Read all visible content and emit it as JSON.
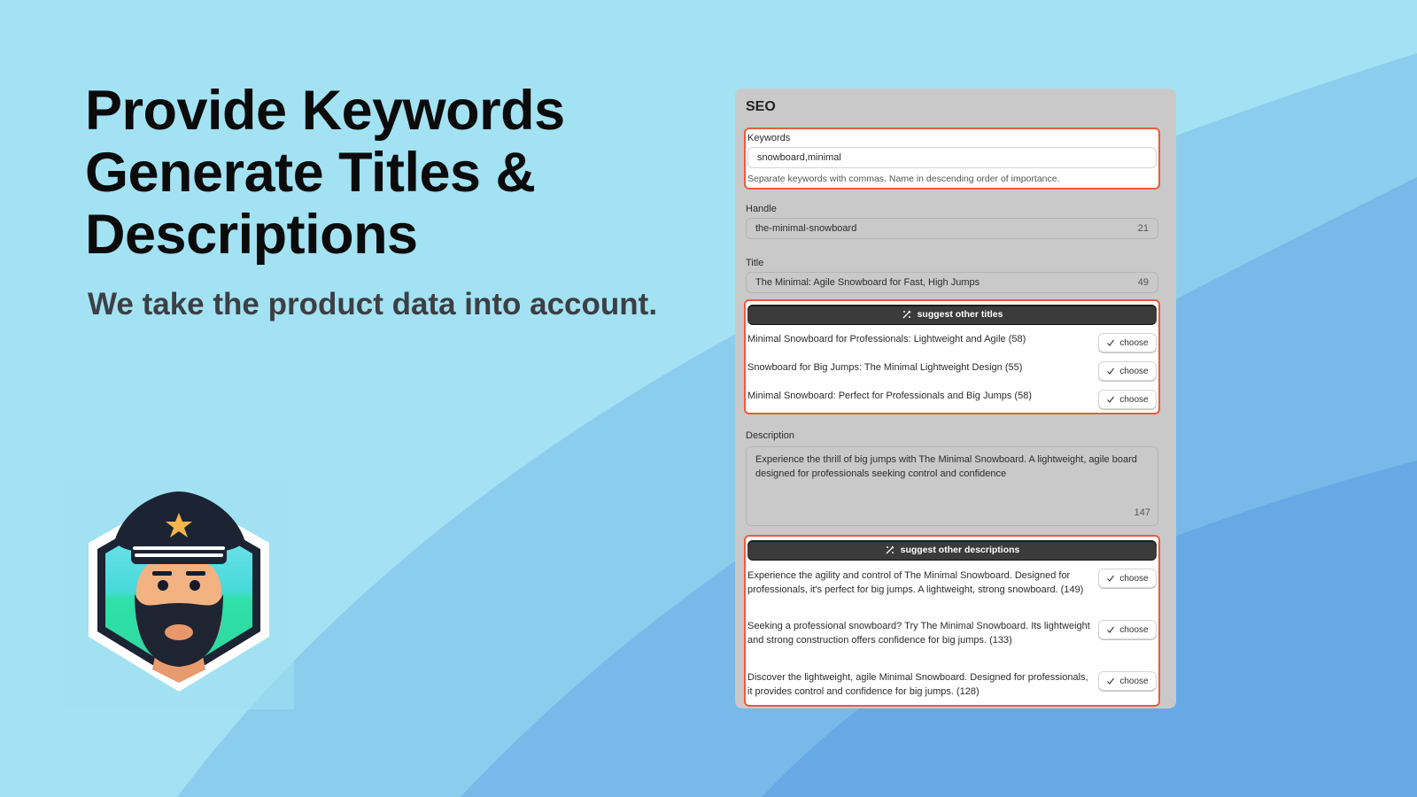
{
  "hero": {
    "title_lines": [
      "Provide Keywords",
      "Generate Titles &",
      "Descriptions"
    ],
    "subtitle": "We take the product data into account."
  },
  "mascot": {
    "icon": "captain-avatar-icon"
  },
  "panel": {
    "title": "SEO",
    "keywords": {
      "label": "Keywords",
      "value": "snowboard,minimal",
      "help": "Separate keywords with commas. Name in descending order of importance."
    },
    "handle": {
      "label": "Handle",
      "value": "the-minimal-snowboard",
      "count": "21"
    },
    "title_field": {
      "label": "Title",
      "value": "The Minimal: Agile Snowboard for Fast, High Jumps",
      "count": "49"
    },
    "suggest_titles": {
      "button_label": "suggest other titles",
      "icon": "magic-wand-icon",
      "items": [
        {
          "text": "Minimal Snowboard for Professionals: Lightweight and Agile (58)",
          "action": "choose"
        },
        {
          "text": "Snowboard for Big Jumps: The Minimal Lightweight Design (55)",
          "action": "choose"
        },
        {
          "text": "Minimal Snowboard: Perfect for Professionals and Big Jumps (58)",
          "action": "choose"
        }
      ]
    },
    "description": {
      "label": "Description",
      "value": "Experience the thrill of big jumps with The Minimal Snowboard. A lightweight, agile board designed for professionals seeking control and confidence",
      "count": "147"
    },
    "suggest_descriptions": {
      "button_label": "suggest other descriptions",
      "icon": "magic-wand-icon",
      "items": [
        {
          "text": "Experience the agility and control of The Minimal Snowboard. Designed for professionals, it's perfect for big jumps. A lightweight, strong snowboard. (149)",
          "action": "choose"
        },
        {
          "text": "Seeking a professional snowboard? Try The Minimal Snowboard. Its lightweight and strong construction offers confidence for big jumps. (133)",
          "action": "choose"
        },
        {
          "text": "Discover the lightweight, agile Minimal Snowboard. Designed for professionals, it provides control and confidence for big jumps. (128)",
          "action": "choose"
        }
      ]
    }
  },
  "colors": {
    "background": "#a3e2f3",
    "wave1": "#8ccdee",
    "wave2": "#78b9ea",
    "wave3": "#67a9e5",
    "highlight": "#ef5a3a",
    "panel": "#c9c9c9",
    "dark_button": "#3b3b3b"
  }
}
